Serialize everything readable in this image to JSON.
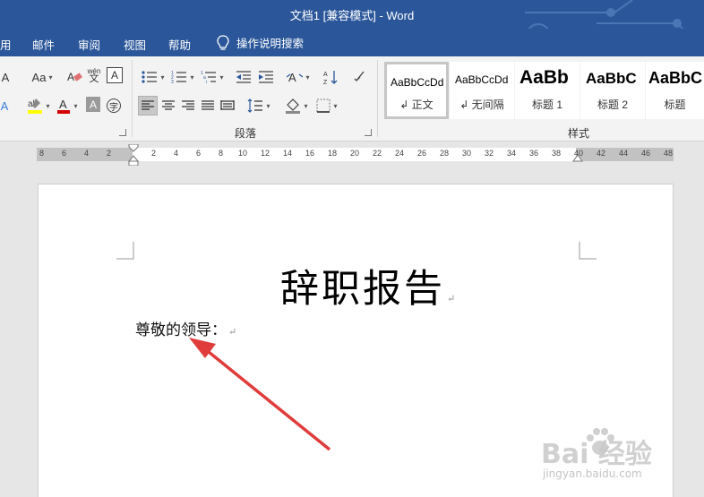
{
  "window": {
    "title": "文档1 [兼容模式]  -  Word"
  },
  "menu": {
    "tabs": [
      "用",
      "邮件",
      "审阅",
      "视图",
      "帮助"
    ],
    "tell_me": "操作说明搜索"
  },
  "ribbon": {
    "font_size_button": "Aa",
    "phonetic_top": "wén",
    "phonetic_bottom": "文",
    "char_border": "A",
    "enclose_char": "字",
    "paragraph_group": "段落",
    "styles_group": "样式",
    "styles": [
      {
        "sample": "AaBbCcDd",
        "name": "↲ 正文"
      },
      {
        "sample": "AaBbCcDd",
        "name": "↲ 无间隔"
      },
      {
        "sample": "AaBb",
        "name": "标题 1"
      },
      {
        "sample": "AaBbC",
        "name": "标题 2"
      },
      {
        "sample": "AaBbC",
        "name": "标题"
      }
    ]
  },
  "ruler": {
    "ticks": [
      "8",
      "6",
      "4",
      "2",
      "2",
      "4",
      "6",
      "8",
      "10",
      "12",
      "14",
      "16",
      "18",
      "20",
      "22",
      "24",
      "26",
      "28",
      "30",
      "32",
      "34",
      "36",
      "38",
      "40",
      "42",
      "44",
      "46",
      "48"
    ]
  },
  "document": {
    "title": "辞职报告",
    "salutation": "尊敬的领导：",
    "paragraph_mark": "↵"
  },
  "watermark": {
    "main": "Bai 经验",
    "sub": "jingyan.baidu.com"
  },
  "colors": {
    "titlebar": "#2b579a",
    "annotation_arrow": "#e03c3c",
    "font_color_bar": "#d40000",
    "highlight_bar": "#ffff00"
  }
}
